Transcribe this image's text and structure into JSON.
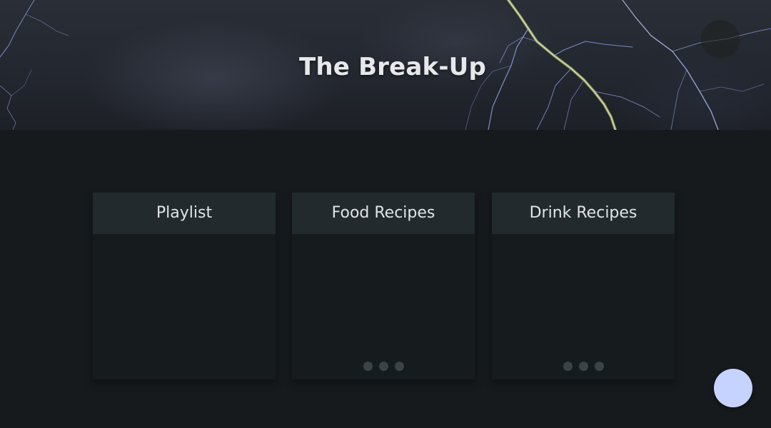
{
  "header": {
    "title": "The Break-Up"
  },
  "cards": [
    {
      "title": "Playlist",
      "loading": false
    },
    {
      "title": "Food Recipes",
      "loading": true
    },
    {
      "title": "Drink Recipes",
      "loading": true
    }
  ],
  "colors": {
    "background": "#161a1d",
    "card_header": "#222a2d",
    "card_body": "#161b1e",
    "loading_dot": "#3a4448",
    "fab": "#c7d3ff",
    "lightning": "#c9d6ff"
  },
  "icons": {
    "hero_background": "lightning-storm-image",
    "loading_indicator": "loading-dots-icon",
    "fab": "floating-action-button"
  }
}
